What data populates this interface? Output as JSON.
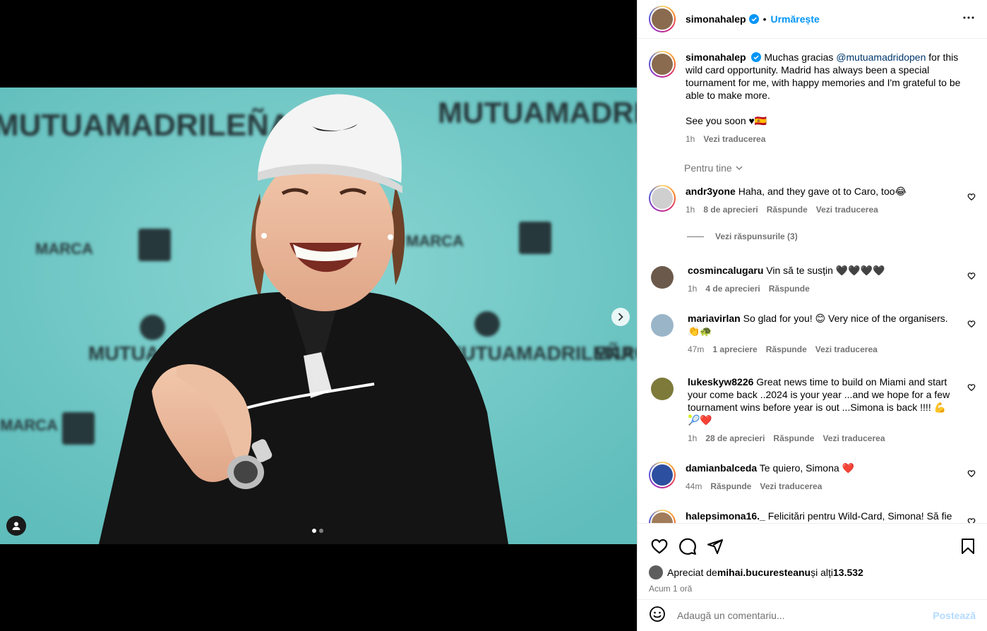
{
  "header": {
    "username": "simonahalep",
    "bullet": "•",
    "follow_label": "Urmărește"
  },
  "caption": {
    "username": "simonahalep",
    "text_before": "Muchas gracias ",
    "mention": "@mutuamadridopen",
    "text_after": " for this wild card opportunity. Madrid has always been a special tournament for me, with happy memories and I'm grateful to be able to make more.",
    "line2": "See you soon ♥🇪🇸",
    "time": "1h",
    "translate": "Vezi traducerea"
  },
  "pentru_tine": "Pentru tine",
  "comments": [
    {
      "username": "andr3yone",
      "text": "Haha, and they gave ot to Caro, too😂",
      "time": "1h",
      "likes": "8 de aprecieri",
      "reply": "Răspunde",
      "translate": "Vezi traducerea",
      "avatar_color": "#cfcfcf"
    },
    {
      "username": "cosmincalugaru",
      "text": "Vin să te susțin 🖤🖤🖤🖤",
      "time": "1h",
      "likes": "4 de aprecieri",
      "reply": "Răspunde",
      "translate": "",
      "avatar_color": "#6b5a4c"
    },
    {
      "username": "mariavirlan",
      "text": "So glad for you! 😊 Very nice of the organisers. 👏🐢",
      "time": "47m",
      "likes": "1 apreciere",
      "reply": "Răspunde",
      "translate": "Vezi traducerea",
      "avatar_color": "#9ab5c8"
    },
    {
      "username": "lukeskyw8226",
      "text": "Great news time to build on Miami and start your come back ..2024 is your year ...and we hope for a few tournament wins before year is out ...Simona is back !!!! 💪🎾❤️",
      "time": "1h",
      "likes": "28 de aprecieri",
      "reply": "Răspunde",
      "translate": "Vezi traducerea",
      "avatar_color": "#7d7a3a"
    },
    {
      "username": "damianbalceda",
      "text": "Te quiero, Simona ❤️",
      "time": "44m",
      "likes": "",
      "reply": "Răspunde",
      "translate": "Vezi traducerea",
      "avatar_color": "#2d4fa0"
    },
    {
      "username": "halepsimona16._",
      "text": "Felicitări pentru Wild-Card, Simona! Să fie bine primit! Ai jucat foarte bine ultima dată la Madrid! Te susținem! 🤗❤️",
      "time": "",
      "likes": "",
      "reply": "",
      "translate": "",
      "avatar_color": "#a07c5a"
    }
  ],
  "replies_label": "Vezi răspunsurile (3)",
  "likes_line": {
    "prefix": "Apreciat de ",
    "user": "mihai.bucuresteanu",
    "middle": " și alți ",
    "count": "13.532"
  },
  "post_time": "Acum 1 oră",
  "add_comment": {
    "placeholder": "Adaugă un comentariu...",
    "post_label": "Postează"
  },
  "photo": {
    "brand_text_1": "MUTUAMADRILEÑA",
    "brand_text_2": "MUTUAMADRI",
    "marca": "MARCA",
    "cap_brand": "",
    "colors": {
      "backdrop": "#7ccfcd",
      "jacket": "#111111",
      "cap": "#f4f4f4"
    }
  },
  "carousel": {
    "total": 2,
    "active": 1
  }
}
